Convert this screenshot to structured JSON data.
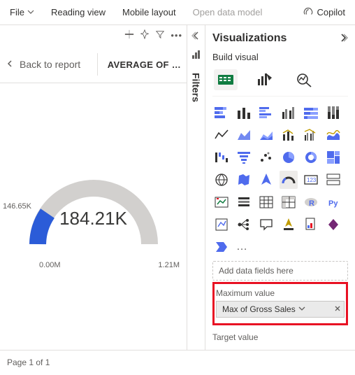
{
  "topbar": {
    "file": "File",
    "reading_view": "Reading view",
    "mobile_layout": "Mobile layout",
    "open_data_model": "Open data model",
    "copilot": "Copilot"
  },
  "report": {
    "back": "Back to report",
    "title": "AVERAGE OF …"
  },
  "gauge": {
    "value_label": "146.65K",
    "center": "184.21K",
    "min": "0.00M",
    "max": "1.21M"
  },
  "filters": {
    "label": "Filters"
  },
  "viz": {
    "title": "Visualizations",
    "build": "Build visual",
    "more": "…",
    "add_placeholder": "Add data fields here",
    "max_label": "Maximum value",
    "max_field": "Max of Gross Sales",
    "target_label": "Target value"
  },
  "footer": {
    "page": "Page 1 of 1"
  },
  "chart_data": {
    "type": "gauge",
    "title": "AVERAGE OF …",
    "value": 184210,
    "value_display": "184.21K",
    "min": 0,
    "max": 1210000,
    "tick_labels": [
      "0.00M",
      "1.21M"
    ],
    "marker": {
      "label": "146.65K",
      "value": 146650
    },
    "fill_color": "#2b5cd8",
    "track_color": "#d2d0ce"
  }
}
